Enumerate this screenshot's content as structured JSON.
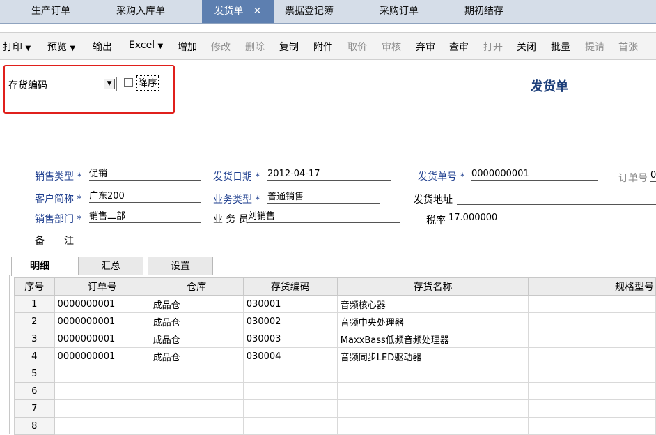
{
  "tabs": [
    {
      "label": "生产订单"
    },
    {
      "label": "采购入库单"
    },
    {
      "label": "发货单",
      "close": "✕"
    },
    {
      "label": "票据登记簿"
    },
    {
      "label": "采购订单"
    },
    {
      "label": "期初结存"
    }
  ],
  "toolbar": {
    "print": "打印",
    "preview": "预览",
    "dropdown_arrow": "▼",
    "output": "输出",
    "excel": "Excel",
    "add": "增加",
    "modify": "修改",
    "delete": "删除",
    "copy": "复制",
    "attach": "附件",
    "price": "取价",
    "audit": "审核",
    "abandon": "弃审",
    "check": "查审",
    "open": "打开",
    "close": "关闭",
    "batch": "批量",
    "submit": "提请",
    "first": "首张"
  },
  "filter": {
    "select_value": "存货编码",
    "checkbox_label": "降序"
  },
  "doc_title": "发货单",
  "form": {
    "sales_type_label": "销售类型",
    "sales_type": "促销",
    "ship_date_label": "发货日期",
    "ship_date": "2012-04-17",
    "ship_no_label": "发货单号",
    "ship_no": "0000000001",
    "order_no_label": "订单号",
    "order_no": "0",
    "customer_label": "客户简称",
    "customer": "广东200",
    "biz_type_label": "业务类型",
    "biz_type": "普通销售",
    "address_label": "发货地址",
    "address": "",
    "dept_label": "销售部门",
    "dept": "销售二部",
    "salesman_label": "业 务 员",
    "salesman": "刘销售",
    "tax_label": "税率",
    "tax": "17.000000",
    "remark_label_1": "备",
    "remark_label_2": "注",
    "remark": "",
    "required_mark": "*"
  },
  "subtabs": [
    {
      "label": "明细"
    },
    {
      "label": "汇总"
    },
    {
      "label": "设置"
    }
  ],
  "grid": {
    "headers": [
      "序号",
      "订单号",
      "仓库",
      "存货编码",
      "存货名称",
      "规格型号"
    ],
    "rows": [
      [
        "1",
        "0000000001",
        "成品仓",
        "030001",
        "音频核心器"
      ],
      [
        "2",
        "0000000001",
        "成品仓",
        "030002",
        "音频中央处理器"
      ],
      [
        "3",
        "0000000001",
        "成品仓",
        "030003",
        "MaxxBass低频音频处理器"
      ],
      [
        "4",
        "0000000001",
        "成品仓",
        "030004",
        "音频同步LED驱动器"
      ],
      [
        "5",
        "",
        "",
        "",
        ""
      ],
      [
        "6",
        "",
        "",
        "",
        ""
      ],
      [
        "7",
        "",
        "",
        "",
        ""
      ],
      [
        "8",
        "",
        "",
        "",
        ""
      ]
    ]
  }
}
